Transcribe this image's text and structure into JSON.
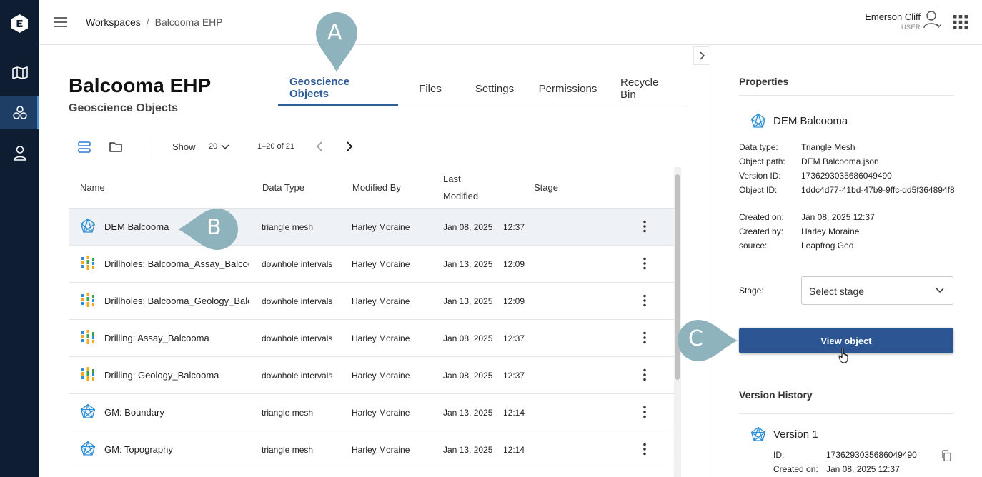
{
  "breadcrumb": {
    "root": "Workspaces",
    "separator": "/",
    "current": "Balcooma EHP"
  },
  "user": {
    "name": "Emerson Cliff",
    "role": "USER"
  },
  "page": {
    "title": "Balcooma EHP",
    "subtitle": "Geoscience Objects"
  },
  "tabs": [
    {
      "label": "Geoscience Objects",
      "active": true
    },
    {
      "label": "Files"
    },
    {
      "label": "Settings"
    },
    {
      "label": "Permissions"
    },
    {
      "label": "Recycle Bin"
    }
  ],
  "toolbar": {
    "show_label": "Show",
    "page_size": "20",
    "page_range": "1–20 of 21"
  },
  "table": {
    "headers": {
      "name": "Name",
      "data_type": "Data Type",
      "modified_by": "Modified By",
      "last_modified_1": "Last",
      "last_modified_2": "Modified",
      "stage": "Stage"
    },
    "rows": [
      {
        "icon": "mesh-icon",
        "name": "DEM Balcooma",
        "type": "triangle mesh",
        "by": "Harley Moraine",
        "date": "Jan 08, 2025",
        "time": "12:37",
        "selected": true
      },
      {
        "icon": "drillhole-icon",
        "name": "Drillholes: Balcooma_Assay_Balcooma",
        "type": "downhole intervals",
        "by": "Harley Moraine",
        "date": "Jan 13, 2025",
        "time": "12:09"
      },
      {
        "icon": "drillhole-icon",
        "name": "Drillholes: Balcooma_Geology_Balcooma",
        "type": "downhole intervals",
        "by": "Harley Moraine",
        "date": "Jan 13, 2025",
        "time": "12:09"
      },
      {
        "icon": "drillhole-icon",
        "name": "Drilling: Assay_Balcooma",
        "type": "downhole intervals",
        "by": "Harley Moraine",
        "date": "Jan 08, 2025",
        "time": "12:37"
      },
      {
        "icon": "drillhole-icon",
        "name": "Drilling: Geology_Balcooma",
        "type": "downhole intervals",
        "by": "Harley Moraine",
        "date": "Jan 08, 2025",
        "time": "12:37"
      },
      {
        "icon": "mesh-icon",
        "name": "GM: Boundary",
        "type": "triangle mesh",
        "by": "Harley Moraine",
        "date": "Jan 13, 2025",
        "time": "12:14"
      },
      {
        "icon": "mesh-icon",
        "name": "GM: Topography",
        "type": "triangle mesh",
        "by": "Harley Moraine",
        "date": "Jan 13, 2025",
        "time": "12:14"
      }
    ]
  },
  "properties": {
    "heading": "Properties",
    "object_name": "DEM Balcooma",
    "fields": [
      {
        "k": "Data type:",
        "v": "Triangle Mesh"
      },
      {
        "k": "Object path:",
        "v": "DEM Balcooma.json"
      },
      {
        "k": "Version ID:",
        "v": "1736293035686049490"
      },
      {
        "k": "Object ID:",
        "v": "1ddc4d77-41bd-47b9-9ffc-dd5f364894f8"
      },
      {
        "k": "Created on:",
        "v": "Jan 08, 2025   12:37"
      },
      {
        "k": "Created by:",
        "v": "Harley Moraine"
      },
      {
        "k": "source:",
        "v": "Leapfrog Geo"
      }
    ],
    "stage_label": "Stage:",
    "stage_placeholder": "Select stage",
    "view_button": "View object"
  },
  "version_history": {
    "heading": "Version History",
    "version_label": "Version 1",
    "id_label": "ID:",
    "id_value": "1736293035686049490",
    "created_label": "Created on:",
    "created_value": "Jan 08, 2025   12:37"
  },
  "callouts": {
    "a": "A",
    "b": "B",
    "c": "C"
  },
  "colors": {
    "rail": "#0f1d33",
    "accent": "#2e5d97",
    "button": "#2b5693",
    "callout": "#8fb3bd"
  }
}
